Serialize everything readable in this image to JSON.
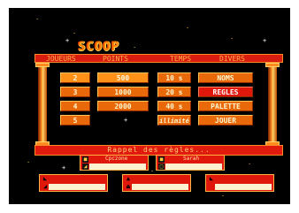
{
  "game": {
    "logo_text": "SCOOP",
    "menu": [
      "JOUEURS",
      "POINTS",
      "TEMPS",
      "DIVERS"
    ],
    "players": [
      "2",
      "3",
      "4",
      "5"
    ],
    "points": [
      "500",
      "1000",
      "2000"
    ],
    "times": [
      "10 s",
      "20 s",
      "40 s",
      "illimité"
    ],
    "divers": [
      "NOMS",
      "REGLES",
      "PALETTE",
      "JOUER"
    ],
    "help_text": "Rappel des règles...",
    "player_panels": [
      {
        "name": "Cpczone"
      },
      {
        "name": "Sarah"
      }
    ],
    "colors": {
      "menu_bar": "#d81c10",
      "button": "#e8680a",
      "button_selected": "#e0180c",
      "background": "#000000",
      "text": "#ffb347"
    }
  }
}
